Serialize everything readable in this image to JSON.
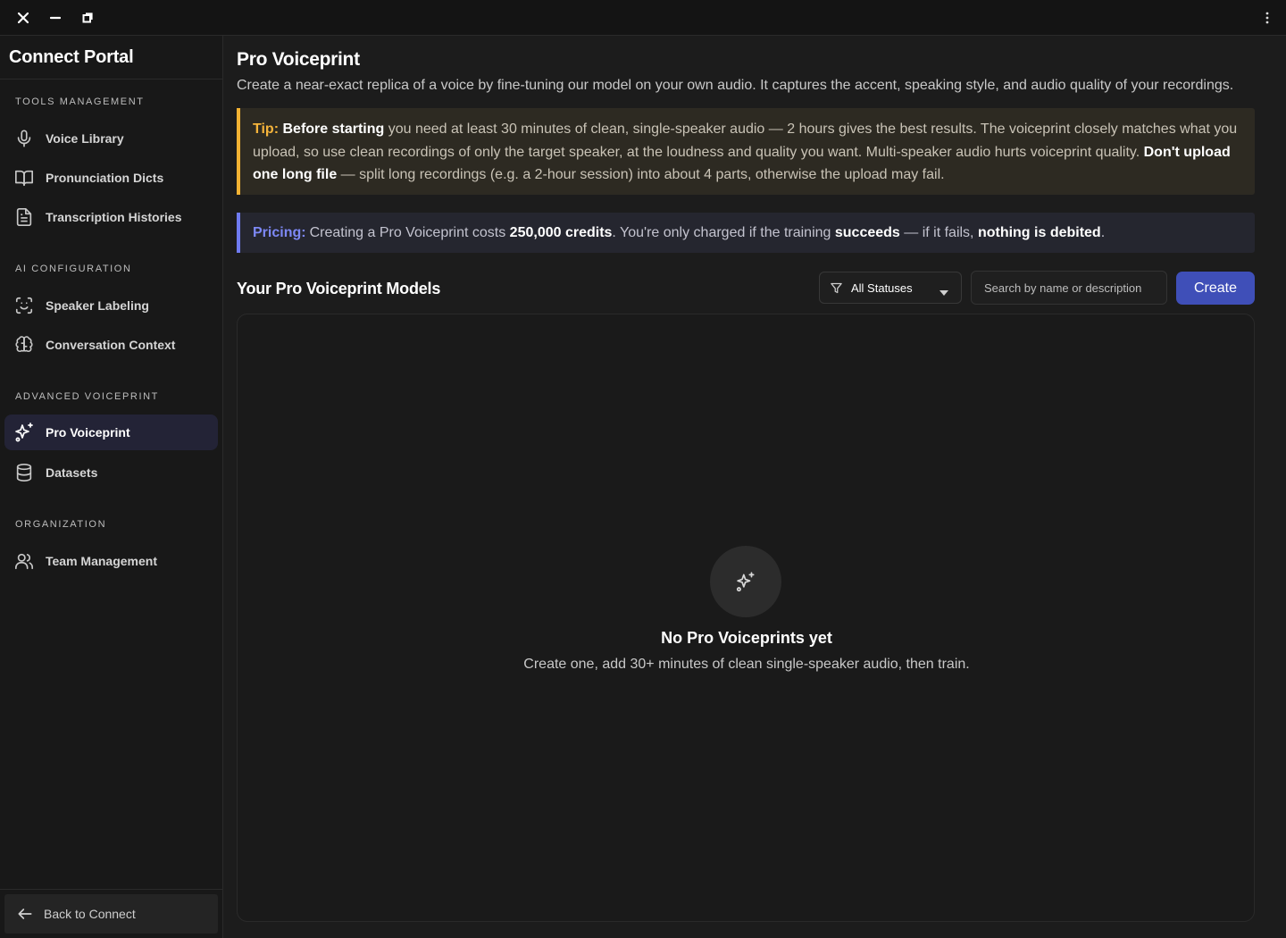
{
  "window": {
    "close_icon": "close-icon",
    "minimize_icon": "minimize-icon",
    "restore_icon": "restore-icon",
    "menu_icon": "kebab-menu-icon"
  },
  "sidebar": {
    "brand": "Connect Portal",
    "sections": [
      {
        "label": "TOOLS MANAGEMENT",
        "items": [
          {
            "label": "Voice Library",
            "icon": "microphone-icon"
          },
          {
            "label": "Pronunciation Dicts",
            "icon": "book-icon"
          },
          {
            "label": "Transcription Histories",
            "icon": "document-icon"
          }
        ]
      },
      {
        "label": "AI CONFIGURATION",
        "items": [
          {
            "label": "Speaker Labeling",
            "icon": "scan-face-icon"
          },
          {
            "label": "Conversation Context",
            "icon": "brain-icon"
          }
        ]
      },
      {
        "label": "ADVANCED VOICEPRINT",
        "items": [
          {
            "label": "Pro Voiceprint",
            "icon": "sparkles-icon",
            "active": true
          },
          {
            "label": "Datasets",
            "icon": "database-icon"
          }
        ]
      },
      {
        "label": "ORGANIZATION",
        "items": [
          {
            "label": "Team Management",
            "icon": "users-icon"
          }
        ]
      }
    ],
    "back_label": "Back to Connect"
  },
  "main": {
    "title": "Pro Voiceprint",
    "description": "Create a near-exact replica of a voice by fine-tuning our model on your own audio. It captures the accent, speaking style, and audio quality of your recordings.",
    "tip": {
      "lead": "Tip:",
      "b1": "Before starting",
      "t1": " you need at least 30 minutes of clean, single-speaker audio — 2 hours gives the best results. The voiceprint closely matches what you upload, so use clean recordings of only the target speaker, at the loudness and quality you want. Multi-speaker audio hurts voiceprint quality. ",
      "b2": "Don't upload one long file",
      "t2": " — split long recordings (e.g. a 2-hour session) into about 4 parts, otherwise the upload may fail."
    },
    "pricing": {
      "lead": "Pricing:",
      "t1": "Creating a Pro Voiceprint costs ",
      "b1": "250,000 credits",
      "t2": ". You're only charged if the training ",
      "b2": "succeeds",
      "t3": " — if it fails, ",
      "b3": "nothing is debited",
      "t4": "."
    },
    "models_title": "Your Pro Voiceprint Models",
    "status_filter": "All Statuses",
    "search_placeholder": "Search by name or description",
    "create_label": "Create",
    "empty": {
      "title": "No Pro Voiceprints yet",
      "subtitle": "Create one, add 30+ minutes of clean single-speaker audio, then train."
    }
  },
  "colors": {
    "tip_accent": "#f2b233",
    "pricing_accent": "#6f7bf0",
    "create_button": "#3f4fb8",
    "active_nav": "#232336"
  }
}
